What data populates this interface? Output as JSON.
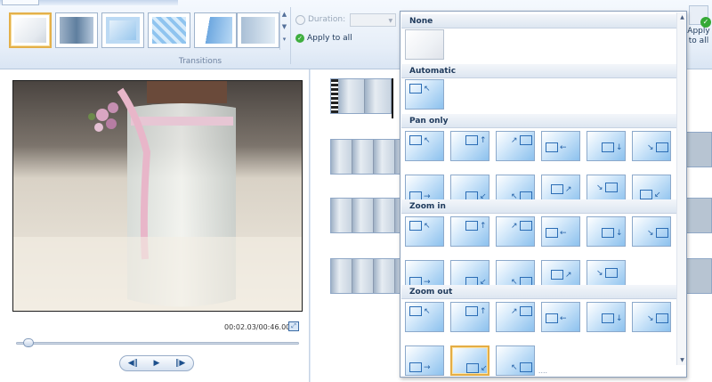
{
  "ribbon": {
    "group_label": "Transitions",
    "duration_label": "Duration:",
    "duration_value": "",
    "apply_small_label": "Apply to all",
    "apply_big_line1": "Apply",
    "apply_big_line2": "to all"
  },
  "preview": {
    "time": "00:02.03/00:46.00",
    "playhead_fraction": 0.045,
    "controls": [
      "◀‖",
      "▶",
      "‖▶"
    ]
  },
  "effects_menu": {
    "sections": [
      {
        "title": "None",
        "count": 1
      },
      {
        "title": "Automatic",
        "count": 1
      },
      {
        "title": "Pan only",
        "count": 12
      },
      {
        "title": "Zoom in",
        "count": 11
      },
      {
        "title": "Zoom out",
        "count": 9
      }
    ],
    "selected": "zoom-out-8",
    "grip": "....",
    "scroll_up": "▲",
    "scroll_down": "▼"
  },
  "colors": {
    "accent": "#1e395b",
    "selection": "#e4ad45",
    "thumb_blue": "#8cc1ee"
  }
}
